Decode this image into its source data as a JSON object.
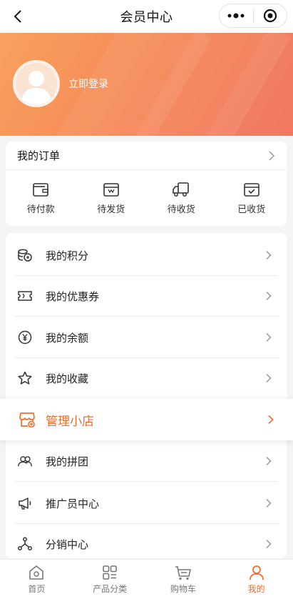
{
  "header": {
    "title": "会员中心"
  },
  "profile": {
    "login_label": "立即登录"
  },
  "orders": {
    "title": "我的订单",
    "items": [
      {
        "label": "待付款",
        "icon": "wallet-icon"
      },
      {
        "label": "待发货",
        "icon": "package-icon"
      },
      {
        "label": "待收货",
        "icon": "truck-icon"
      },
      {
        "label": "已收货",
        "icon": "box-check-icon"
      }
    ]
  },
  "menu": {
    "items": [
      {
        "label": "我的积分",
        "icon": "coins-icon"
      },
      {
        "label": "我的优惠券",
        "icon": "coupon-icon"
      },
      {
        "label": "我的余额",
        "icon": "yen-icon"
      },
      {
        "label": "我的收藏",
        "icon": "star-icon"
      },
      {
        "label": "我的拼团",
        "icon": "group-icon"
      },
      {
        "label": "推广员中心",
        "icon": "megaphone-icon"
      },
      {
        "label": "分销中心",
        "icon": "share-icon"
      }
    ],
    "shop": {
      "label": "管理小店",
      "icon": "shop-icon"
    }
  },
  "tabbar": {
    "items": [
      {
        "label": "首页",
        "icon": "home-icon"
      },
      {
        "label": "产品分类",
        "icon": "category-icon"
      },
      {
        "label": "购物车",
        "icon": "cart-icon"
      },
      {
        "label": "我的",
        "icon": "user-icon"
      }
    ],
    "active": "我的"
  },
  "colors": {
    "accent": "#f26c2e",
    "hero_start": "#f8a25e",
    "hero_end": "#f16d55"
  }
}
